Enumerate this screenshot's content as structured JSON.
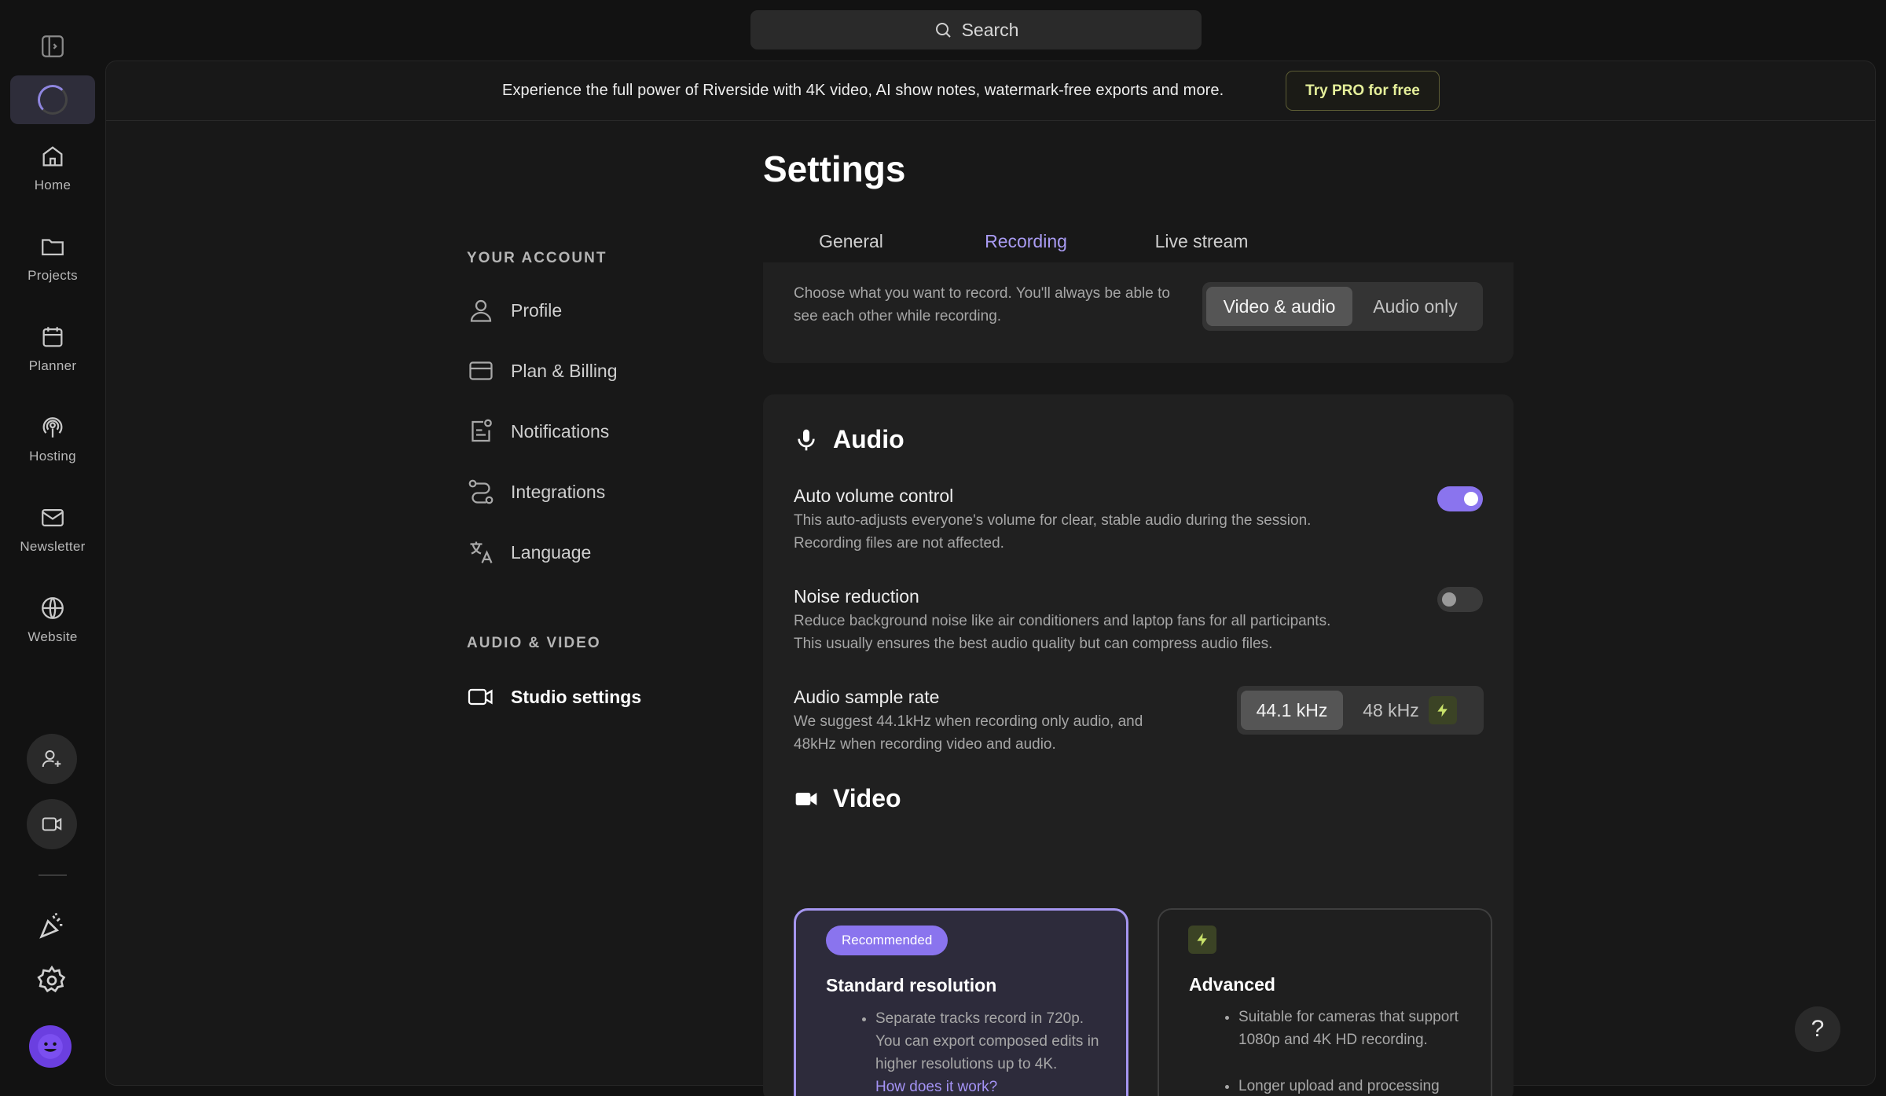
{
  "rail": {
    "items": [
      {
        "label": "Home",
        "icon": "home-icon"
      },
      {
        "label": "Projects",
        "icon": "folder-icon"
      },
      {
        "label": "Planner",
        "icon": "calendar-icon"
      },
      {
        "label": "Hosting",
        "icon": "podcast-icon"
      },
      {
        "label": "Newsletter",
        "icon": "mail-icon"
      },
      {
        "label": "Website",
        "icon": "globe-icon"
      }
    ]
  },
  "search": {
    "label": "Search"
  },
  "banner": {
    "text": "Experience the full power of Riverside with 4K video, AI show notes, watermark-free exports and more.",
    "cta": "Try PRO for free"
  },
  "page": {
    "title": "Settings"
  },
  "settings_nav": {
    "account_heading": "YOUR ACCOUNT",
    "account_items": [
      "Profile",
      "Plan & Billing",
      "Notifications",
      "Integrations",
      "Language"
    ],
    "av_heading": "AUDIO & VIDEO",
    "av_items": [
      "Studio settings"
    ]
  },
  "tabs": [
    "General",
    "Recording",
    "Live stream"
  ],
  "active_tab": "Recording",
  "record_mode": {
    "description": "Choose what you want to record. You'll always be able to see each other while recording.",
    "options": [
      "Video & audio",
      "Audio only"
    ],
    "selected": "Video & audio"
  },
  "audio": {
    "heading": "Audio",
    "auto_volume": {
      "title": "Auto volume control",
      "description_line1": "This auto-adjusts everyone's volume for clear, stable audio during the session.",
      "description_line2": "Recording files are not affected.",
      "enabled": true
    },
    "noise_reduction": {
      "title": "Noise reduction",
      "description_line1": "Reduce background noise like air conditioners and laptop fans for all participants.",
      "description_line2": "This usually ensures the best audio quality but can compress audio files.",
      "enabled": false
    },
    "sample_rate": {
      "title": "Audio sample rate",
      "description_line1": "We suggest 44.1kHz when recording only audio, and",
      "description_line2": "48kHz when recording video and audio.",
      "options": [
        "44.1 kHz",
        "48 kHz"
      ],
      "selected": "44.1 kHz"
    }
  },
  "video": {
    "heading": "Video",
    "standard": {
      "badge": "Recommended",
      "title": "Standard resolution",
      "bullet": "Separate tracks record in 720p. You can export composed edits in higher resolutions up to 4K.",
      "link": "How does it work?"
    },
    "advanced": {
      "title": "Advanced",
      "bullets": [
        "Suitable for cameras that support 1080p and 4K HD recording.",
        "Longer upload and processing times."
      ]
    }
  },
  "help": {
    "label": "?"
  },
  "colors": {
    "accent": "#8a74ee",
    "pro": "#e5ef9a",
    "background": "#121212"
  }
}
